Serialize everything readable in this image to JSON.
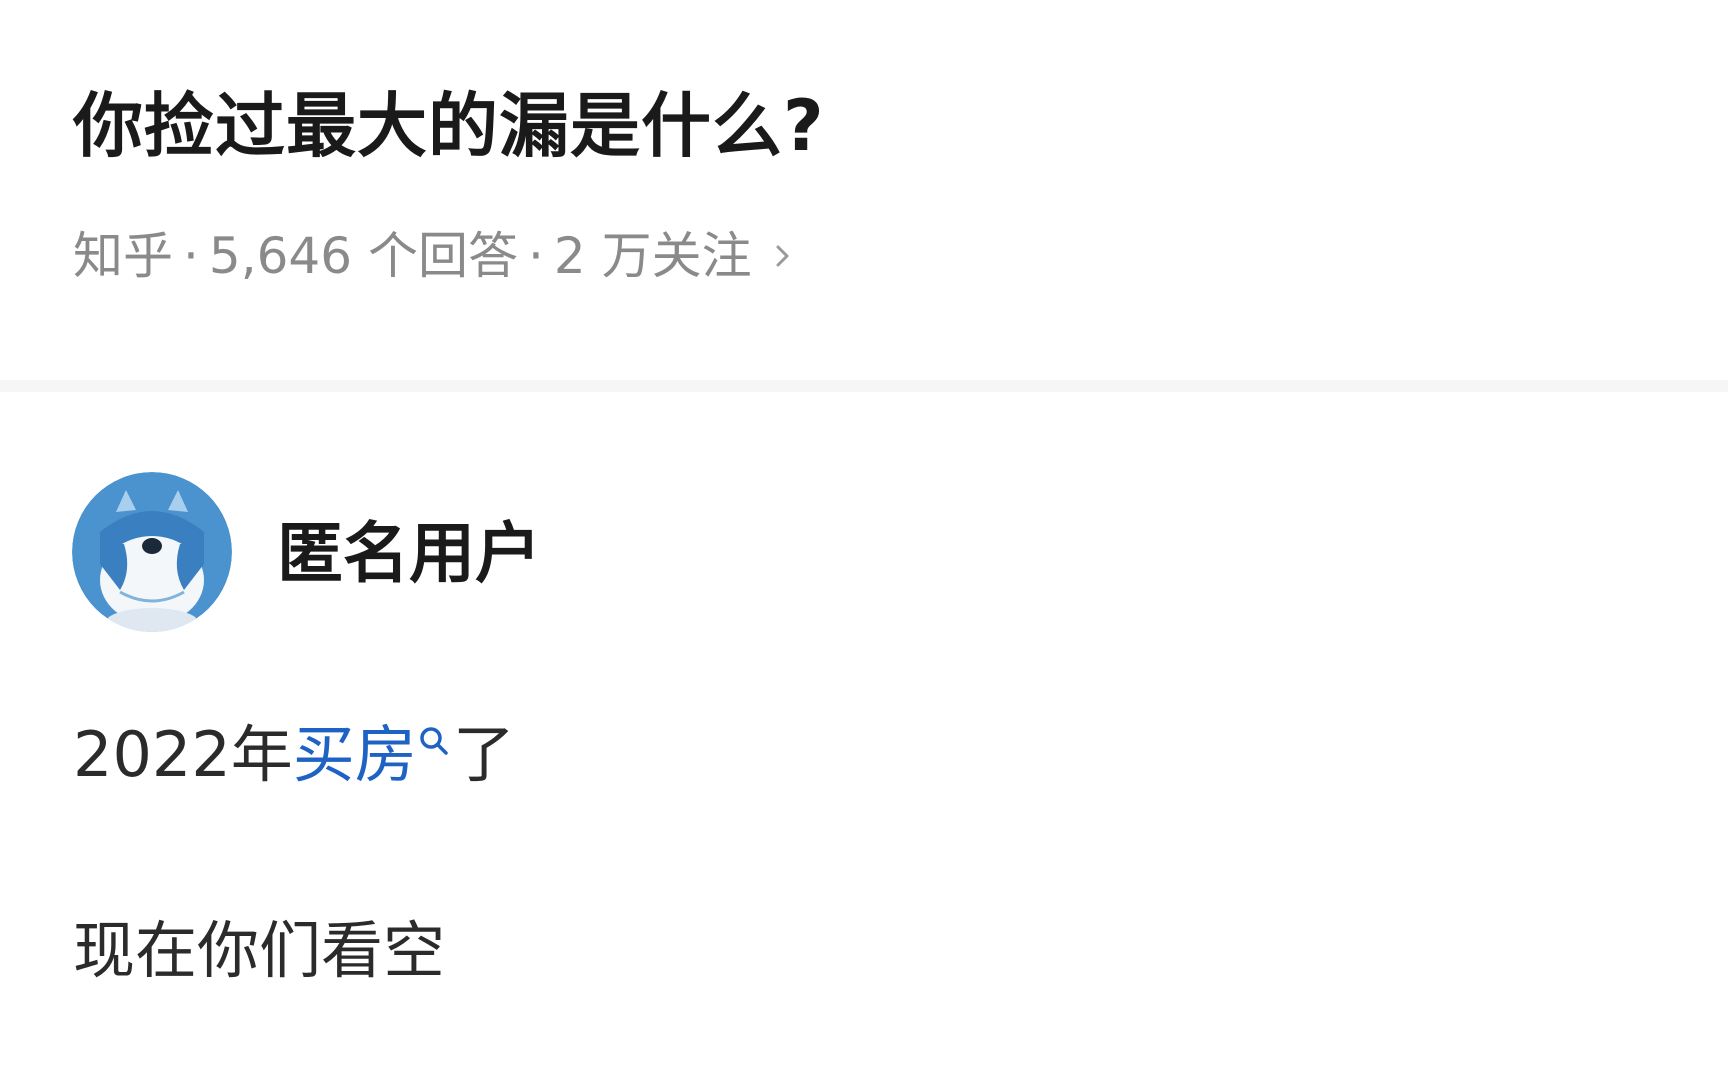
{
  "question": {
    "title": "你捡过最大的漏是什么?",
    "source": "知乎",
    "separator": "·",
    "answer_count": "5,646 个回答",
    "follow_count": "2 万关注",
    "chevron_icon": "chevron-right-icon"
  },
  "answer": {
    "author": {
      "name": "匿名用户",
      "avatar_icon": "anonymous-avatar-icon"
    },
    "line1": {
      "prefix": "2022年",
      "keyword": "买房",
      "keyword_icon": "search-icon",
      "suffix": "了"
    },
    "line2": "现在你们看空"
  },
  "colors": {
    "title": "#1a1a1a",
    "meta": "#8a8a8a",
    "keyword": "#1e62c4",
    "avatar_bg": "#4a93cf"
  }
}
